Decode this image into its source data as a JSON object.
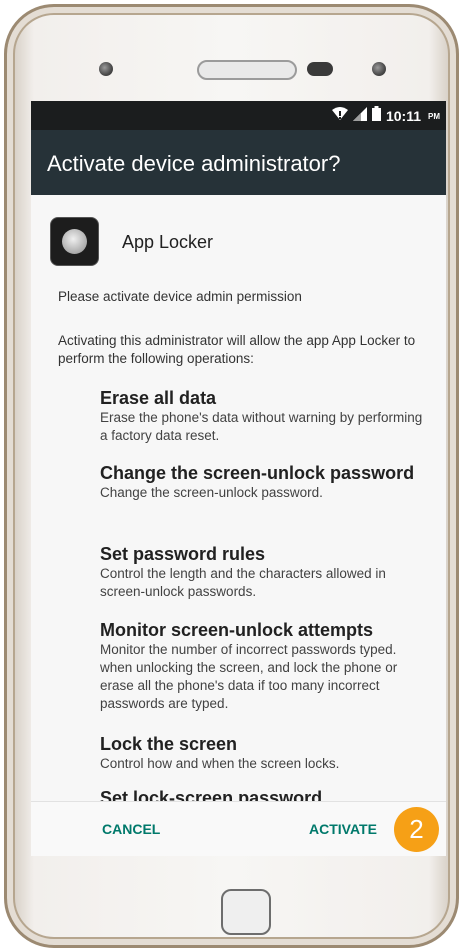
{
  "status_bar": {
    "time": "10:11",
    "ampm": "PM"
  },
  "dialog": {
    "title": "Activate device administrator?",
    "app_name": "App Locker",
    "permission_message": "Please activate device admin permission",
    "intro": "Activating this administrator will allow the app App Locker to perform the following operations:",
    "policies": [
      {
        "title": "Erase all data",
        "description": "Erase the phone's data without warning by performing a factory data reset."
      },
      {
        "title": "Change the screen-unlock password",
        "description": "Change the screen-unlock password."
      },
      {
        "title": "Set password rules",
        "description": "Control the length and the characters allowed in screen-unlock passwords."
      },
      {
        "title": "Monitor screen-unlock attempts",
        "description": "Monitor the number of incorrect passwords typed. when unlocking the screen, and lock the phone or erase all the phone's data if too many incorrect passwords are typed."
      },
      {
        "title": "Lock the screen",
        "description": "Control how and when the screen locks."
      },
      {
        "title": "Set lock-screen password",
        "description": ""
      }
    ],
    "cancel_label": "CANCEL",
    "activate_label": "ACTIVATE"
  },
  "step_badge": "2",
  "colors": {
    "app_bar": "#263238",
    "status_bar": "#1b1d1e",
    "button_text": "#00796b",
    "badge": "#f6a016"
  },
  "icons": [
    "wifi-icon",
    "signal-icon",
    "battery-icon",
    "app-locker-icon"
  ]
}
